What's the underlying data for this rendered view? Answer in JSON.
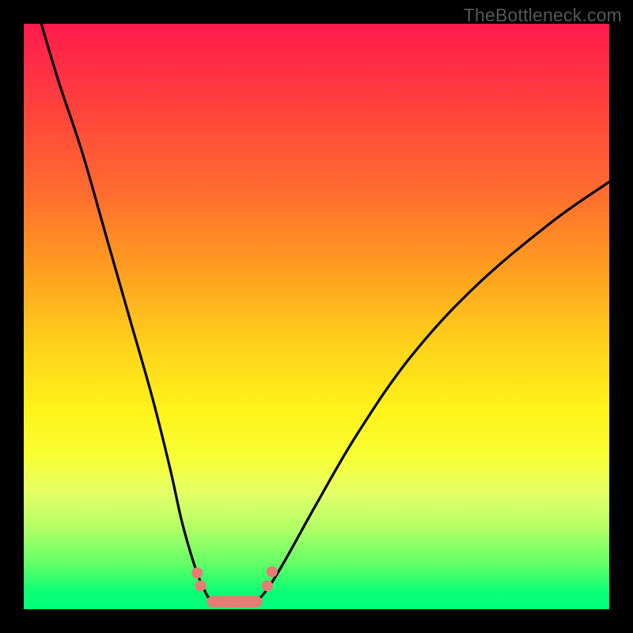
{
  "watermark": "TheBottleneck.com",
  "chart_data": {
    "type": "line",
    "title": "",
    "xlabel": "",
    "ylabel": "",
    "xlim": [
      0,
      100
    ],
    "ylim": [
      0,
      100
    ],
    "grid": false,
    "legend": false,
    "series": [
      {
        "name": "curve-left",
        "x": [
          3,
          6,
          10,
          14,
          18,
          22,
          25,
          27,
          29,
          30.5,
          32
        ],
        "y": [
          100,
          90,
          78,
          64,
          50,
          36,
          24,
          15,
          8,
          4,
          1.5
        ]
      },
      {
        "name": "curve-right",
        "x": [
          40,
          42,
          45,
          50,
          57,
          66,
          77,
          90,
          100
        ],
        "y": [
          1.5,
          4,
          9,
          18,
          30,
          43,
          55,
          66,
          73
        ]
      },
      {
        "name": "floor",
        "x": [
          32,
          34,
          36,
          38,
          40
        ],
        "y": [
          1.5,
          0.8,
          0.6,
          0.8,
          1.5
        ]
      }
    ],
    "markers": {
      "name": "beads",
      "color": "#ea7a74",
      "points_x": [
        29.6,
        30.2,
        41.6,
        42.4
      ],
      "points_y": [
        6.2,
        4.0,
        4.0,
        6.4
      ],
      "flat_segment_x": [
        32.2,
        39.8
      ],
      "flat_segment_y": [
        1.3,
        1.3
      ]
    },
    "background_gradient": {
      "top": "#ff1a4d",
      "mid": "#fff31a",
      "bottom": "#00ff7a"
    }
  }
}
